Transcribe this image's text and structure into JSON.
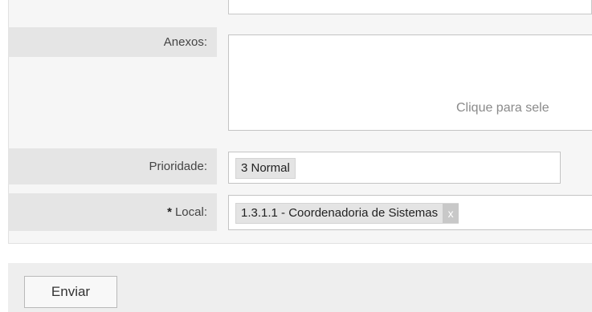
{
  "form": {
    "anexos": {
      "label": "Anexos:",
      "dropzone_text": "Clique para sele"
    },
    "prioridade": {
      "label": "Prioridade:",
      "value": "3 Normal"
    },
    "local": {
      "required_marker": "*",
      "label": "Local:",
      "value": "1.3.1.1 - Coordenadoria de Sistemas",
      "remove_glyph": "x"
    }
  },
  "actions": {
    "submit_label": "Enviar"
  }
}
